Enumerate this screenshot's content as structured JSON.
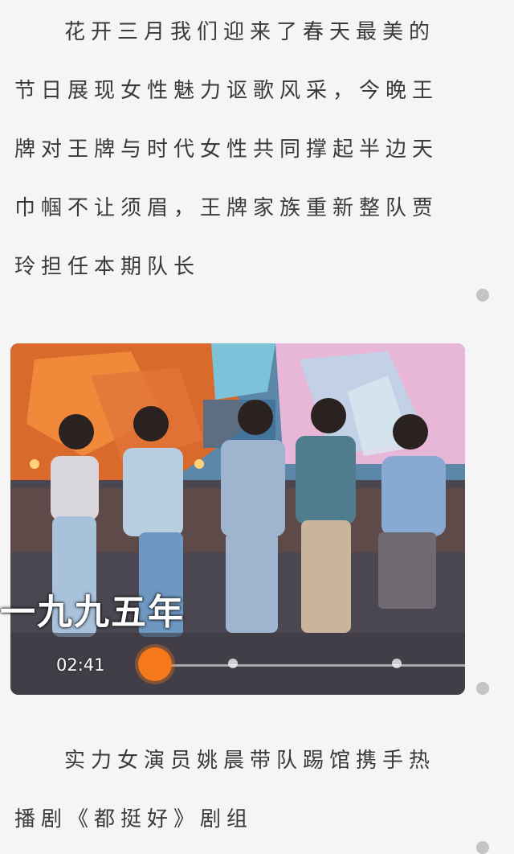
{
  "article": {
    "paragraph1": "花开三月我们迎来了春天最美的节日展现女性魅力讴歌风采，今晚王牌对王牌与时代女性共同撑起半边天巾帼不让须眉，王牌家族重新整队贾玲担任本期队长",
    "paragraph2": "实力女演员姚晨带队踢馆携手热播剧《都挺好》剧组"
  },
  "video": {
    "caption": "一九九五年",
    "time": "02:41",
    "progress_color": "#f5791a"
  },
  "icons": {
    "play_progress": "orange-circle-knob",
    "scroll": "gray-dot"
  }
}
